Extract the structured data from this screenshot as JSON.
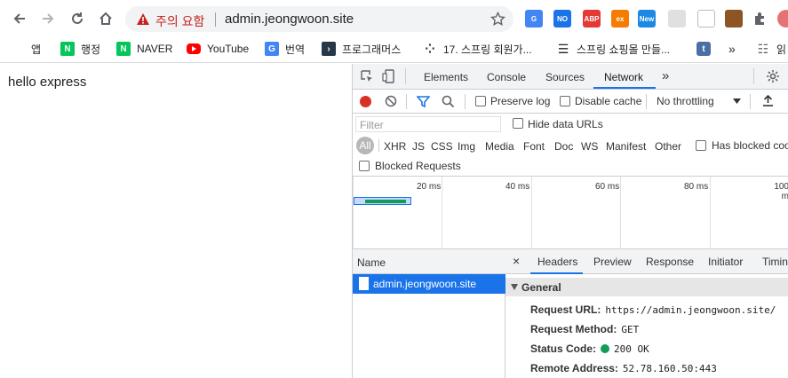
{
  "browser": {
    "security_warning": "주의 요함",
    "url": "admin.jeongwoon.site"
  },
  "extensions": [
    {
      "name": "translate-ext",
      "text": "G",
      "color": "#4285f4"
    },
    {
      "name": "no-ext",
      "text": "NO",
      "color": "#1a73e8"
    },
    {
      "name": "abp-ext",
      "text": "ABP",
      "color": "#e53935"
    },
    {
      "name": "ex-ext",
      "text": "ex",
      "color": "#f57c00"
    },
    {
      "name": "new-ext",
      "text": "New",
      "color": "#1e88e5"
    },
    {
      "name": "grid-ext",
      "text": "",
      "color": "#e0e0e0"
    },
    {
      "name": "circle-ext",
      "text": "",
      "color": "#ffffff"
    },
    {
      "name": "cookie-ext",
      "text": "",
      "color": "#8d5524"
    }
  ],
  "bookmarks": [
    {
      "label": "앱",
      "icon": "apps-icon",
      "color": "#4285f4"
    },
    {
      "label": "행정",
      "icon": "naver-icon",
      "color": "#03c75a"
    },
    {
      "label": "NAVER",
      "icon": "naver-icon",
      "color": "#03c75a"
    },
    {
      "label": "YouTube",
      "icon": "youtube-icon",
      "color": "#ff0000"
    },
    {
      "label": "번역",
      "icon": "translate-icon",
      "color": "#4285f4"
    },
    {
      "label": "프로그래머스",
      "icon": "programmers-icon",
      "color": "#263747"
    },
    {
      "label": "17. 스프링 회원가...",
      "icon": "dots-icon",
      "color": "#333333"
    },
    {
      "label": "스프링 쇼핑몰 만들...",
      "icon": "blog-icon",
      "color": "#222222"
    },
    {
      "label": "",
      "icon": "tistory-icon",
      "color": "#4a6fa5"
    },
    {
      "label": "읽",
      "icon": "reading-list-icon",
      "color": "#5f6368"
    }
  ],
  "page": {
    "text": "hello express"
  },
  "devtools": {
    "tabs": [
      "Elements",
      "Console",
      "Sources",
      "Network"
    ],
    "active_tab": "Network",
    "network": {
      "preserve_log": "Preserve log",
      "disable_cache": "Disable cache",
      "throttling": "No throttling",
      "filter_placeholder": "Filter",
      "hide_data_urls": "Hide data URLs",
      "types": [
        "All",
        "XHR",
        "JS",
        "CSS",
        "Img",
        "Media",
        "Font",
        "Doc",
        "WS",
        "Manifest",
        "Other"
      ],
      "has_blocked": "Has blocked coo",
      "blocked_requests": "Blocked Requests",
      "ticks": [
        "20 ms",
        "40 ms",
        "60 ms",
        "80 ms",
        "100 m"
      ]
    },
    "requests": {
      "header": "Name",
      "rows": [
        "admin.jeongwoon.site"
      ]
    },
    "detail": {
      "tabs": [
        "Headers",
        "Preview",
        "Response",
        "Initiator",
        "Timin"
      ],
      "general_title": "General",
      "fields": [
        {
          "key": "Request URL:",
          "value": "https://admin.jeongwoon.site/"
        },
        {
          "key": "Request Method:",
          "value": "GET"
        },
        {
          "key": "Status Code:",
          "value": "200 OK"
        },
        {
          "key": "Remote Address:",
          "value": "52.78.160.50:443"
        }
      ]
    }
  },
  "colors": {
    "accent": "#1a73e8",
    "record": "#d93025",
    "status_ok": "#0f9d58",
    "timing_bar": "#0f9d58"
  }
}
